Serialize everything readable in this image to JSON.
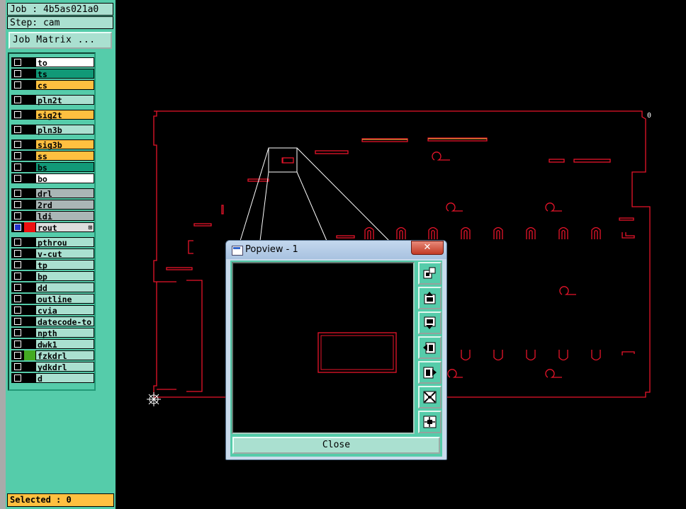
{
  "job": {
    "label": "Job : 4b5as021a0",
    "step": "Step: cam"
  },
  "job_matrix_button": "Job Matrix ...",
  "layers": [
    {
      "name": "to",
      "color": "#ffffff",
      "swatch": "#000000"
    },
    {
      "name": "ts",
      "color": "#119977",
      "swatch": "#000000"
    },
    {
      "name": "cs",
      "color": "#ffc040",
      "swatch": "#000000"
    },
    {
      "name": "pln2t",
      "color": "#aae0d0",
      "swatch": "#000000"
    },
    {
      "name": "sig2t",
      "color": "#ffc040",
      "swatch": "#000000"
    },
    {
      "name": "pln3b",
      "color": "#aae0d0",
      "swatch": "#000000"
    },
    {
      "name": "sig3b",
      "color": "#ffc040",
      "swatch": "#000000"
    },
    {
      "name": "ss",
      "color": "#ffc040",
      "swatch": "#000000"
    },
    {
      "name": "bs",
      "color": "#119977",
      "swatch": "#000000"
    },
    {
      "name": "bo",
      "color": "#ffffff",
      "swatch": "#000000"
    },
    {
      "name": "drl",
      "color": "#aab6b6",
      "swatch": "#000000"
    },
    {
      "name": "2rd",
      "color": "#aab6b6",
      "swatch": "#000000"
    },
    {
      "name": "ldi",
      "color": "#aab6b6",
      "swatch": "#000000"
    },
    {
      "name": "rout",
      "color": "#dddddd",
      "swatch": "#ee1111",
      "selected": true,
      "expand": "⊞"
    },
    {
      "name": "pthrou",
      "color": "#aae0d0",
      "swatch": "#000000"
    },
    {
      "name": "v-cut",
      "color": "#aae0d0",
      "swatch": "#000000"
    },
    {
      "name": "tp",
      "color": "#aae0d0",
      "swatch": "#000000"
    },
    {
      "name": "bp",
      "color": "#aae0d0",
      "swatch": "#000000"
    },
    {
      "name": "dd",
      "color": "#aae0d0",
      "swatch": "#000000"
    },
    {
      "name": "outline",
      "color": "#aae0d0",
      "swatch": "#000000"
    },
    {
      "name": "cvia",
      "color": "#aae0d0",
      "swatch": "#000000"
    },
    {
      "name": "datecode-to",
      "color": "#aae0d0",
      "swatch": "#000000"
    },
    {
      "name": "npth",
      "color": "#aae0d0",
      "swatch": "#000000"
    },
    {
      "name": "dwk1",
      "color": "#aae0d0",
      "swatch": "#000000"
    },
    {
      "name": "fzkdrl",
      "color": "#aae0d0",
      "swatch": "#44aa22"
    },
    {
      "name": "ydkdrl",
      "color": "#aae0d0",
      "swatch": "#000000"
    },
    {
      "name": "d",
      "color": "#aae0d0",
      "swatch": "#000000"
    }
  ],
  "selected_status": "Selected : 0",
  "popview": {
    "title": "Popview - 1",
    "close_x": "✕",
    "close_button": "Close",
    "tools": [
      "zoom-region-icon",
      "pan-up-icon",
      "pan-down-icon",
      "pan-left-icon",
      "pan-right-icon",
      "zoom-out-icon",
      "zoom-in-icon"
    ]
  },
  "board": {
    "origin_marker": "0",
    "line_color": "#e8142a"
  }
}
